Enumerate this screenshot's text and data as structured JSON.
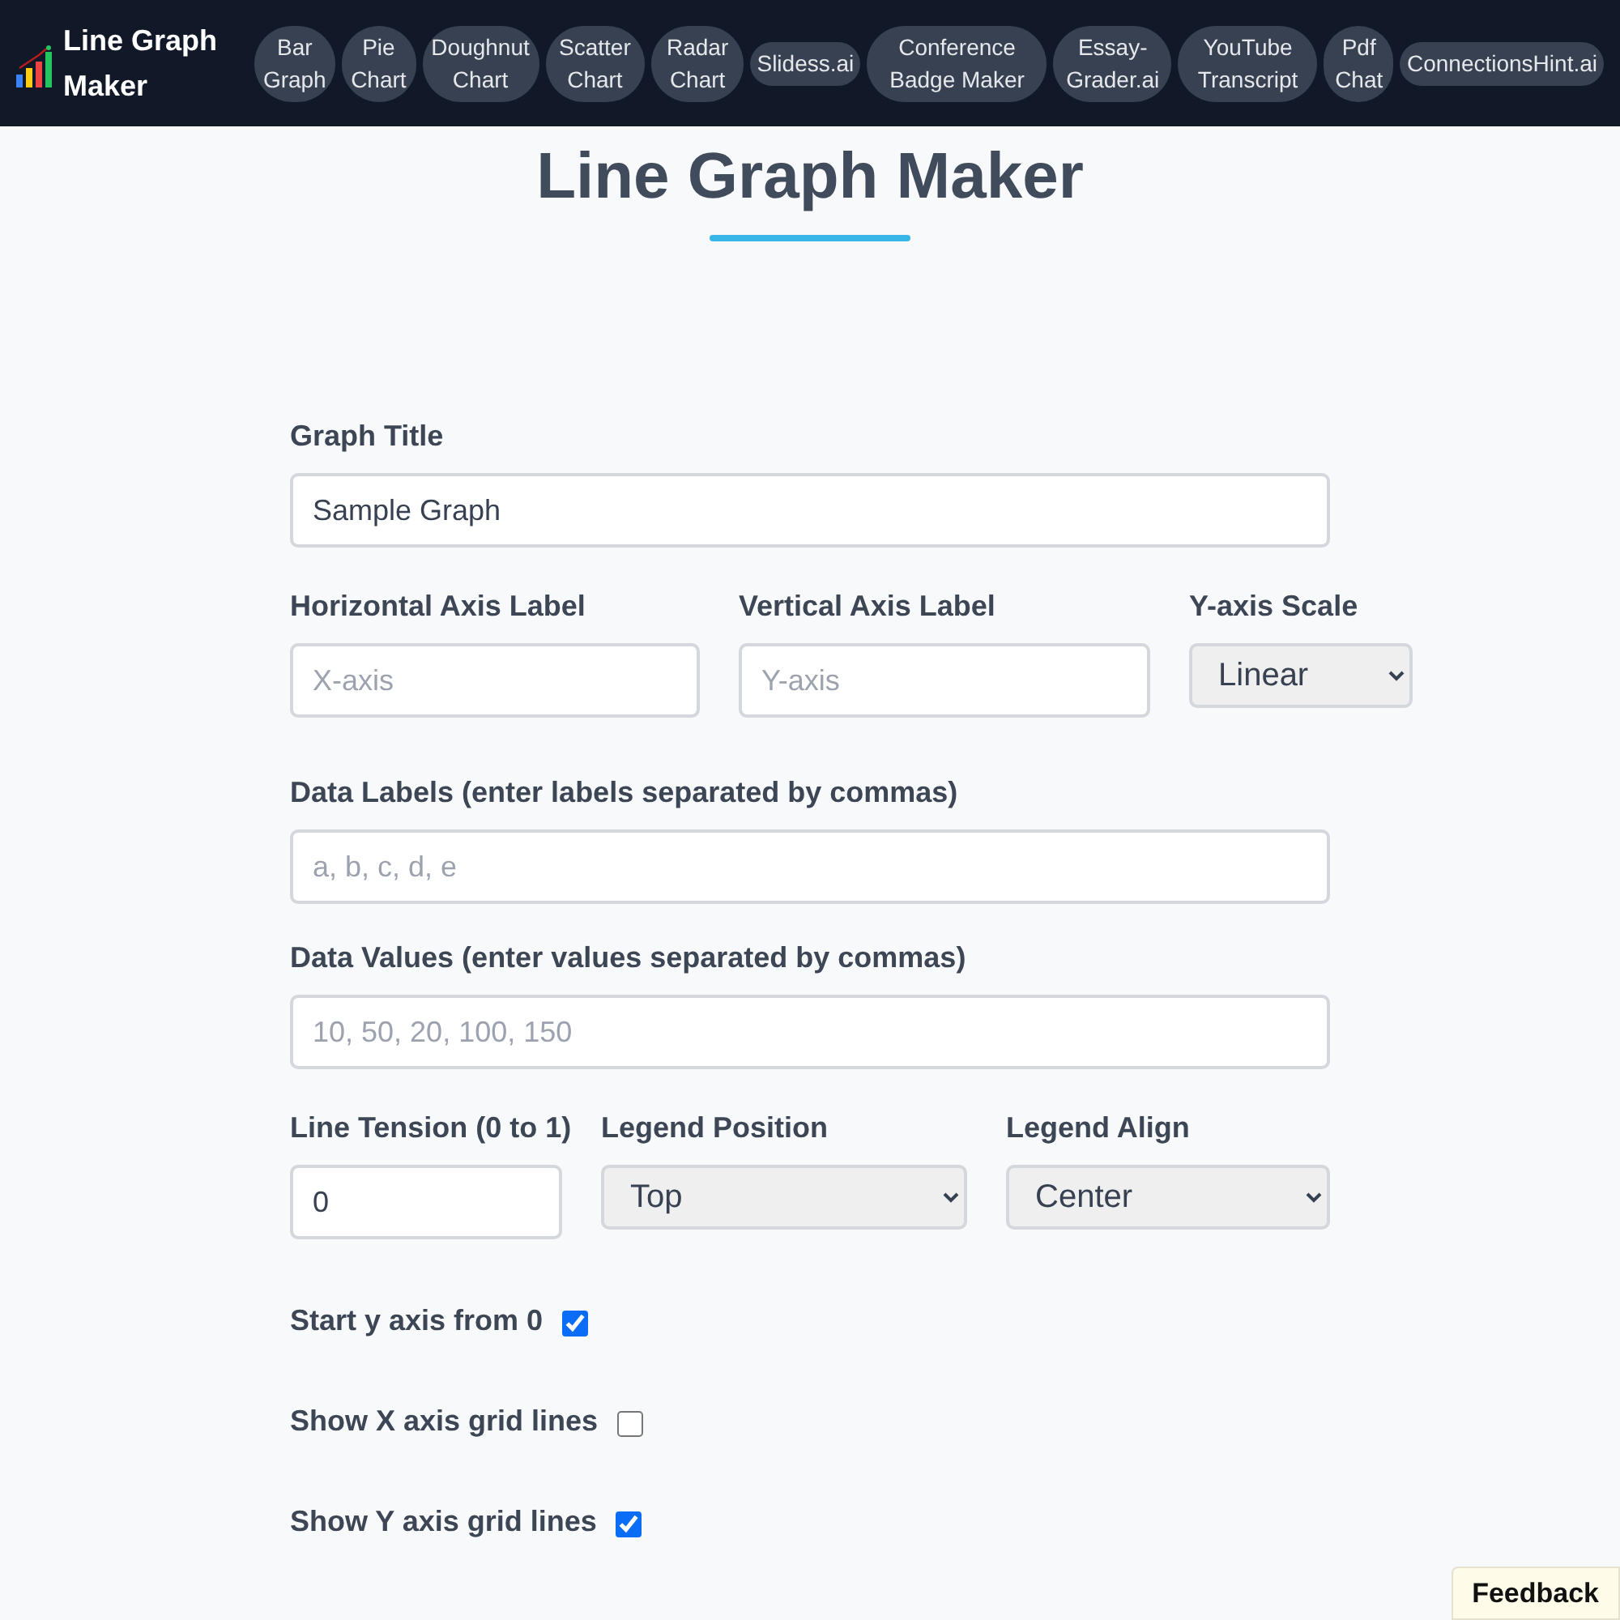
{
  "header": {
    "title": "Line Graph Maker",
    "nav_links": [
      {
        "label": "Bar Graph"
      },
      {
        "label": "Pie Chart"
      },
      {
        "label": "Doughnut Chart"
      },
      {
        "label": "Scatter Chart"
      },
      {
        "label": "Radar Chart"
      },
      {
        "label": "Slidess.ai"
      },
      {
        "label": "Conference Badge Maker"
      },
      {
        "label": "Essay-Grader.ai"
      },
      {
        "label": "YouTube Transcript"
      },
      {
        "label": "Pdf Chat"
      },
      {
        "label": "ConnectionsHint.ai"
      }
    ]
  },
  "heading": {
    "title": "Line Graph Maker"
  },
  "form": {
    "rows": [
      [
        {
          "kind": "text",
          "label": "Graph Title",
          "value": "Sample Graph"
        }
      ],
      [
        {
          "kind": "text",
          "label": "Horizontal Axis Label",
          "placeholder": "X-axis"
        },
        {
          "kind": "text",
          "label": "Vertical Axis Label",
          "placeholder": "Y-axis"
        },
        {
          "kind": "select",
          "label": "Y-axis Scale",
          "value": "Linear"
        }
      ],
      [
        {
          "kind": "text",
          "label": "Data Labels (enter labels separated by commas)",
          "placeholder": "a, b, c, d, e"
        }
      ],
      [
        {
          "kind": "text",
          "label": "Data Values (enter values separated by commas)",
          "placeholder": "10, 50, 20, 100, 150"
        }
      ],
      [
        {
          "kind": "number",
          "label": "Line Tension (0 to 1)",
          "value": "0"
        },
        {
          "kind": "select",
          "label": "Legend Position",
          "value": "Top"
        },
        {
          "kind": "select",
          "label": "Legend Align",
          "value": "Center"
        }
      ]
    ],
    "toggles": [
      {
        "label": "Start y axis from 0",
        "checked": true
      },
      {
        "label": "Show X axis grid lines",
        "checked": false
      },
      {
        "label": "Show Y axis grid lines",
        "checked": true
      }
    ]
  },
  "feedback_button": {
    "label": "Feedback"
  }
}
